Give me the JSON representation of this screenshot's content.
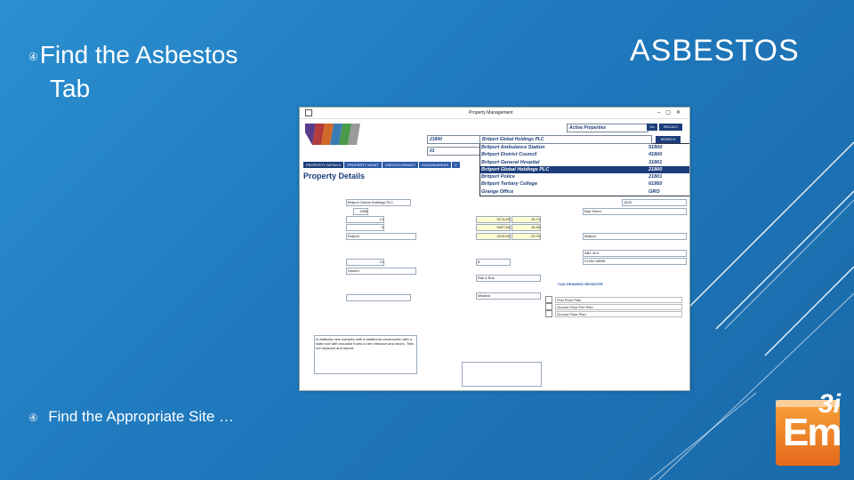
{
  "slide": {
    "bullet1_line1": "Find the Asbestos",
    "bullet1_line2": "Tab",
    "bullet2": "Find the Appropriate Site …",
    "title": "ASBESTOS",
    "bullet_marker": "④"
  },
  "app": {
    "window_title": "Property Management",
    "tabs": [
      "PROPERTY DETAILS",
      "PROPERTY MGMT",
      "USE/OCCUPANCY",
      "ROOMS/AREAS",
      "C"
    ],
    "heading": "Property Details",
    "header_code": "21800",
    "header_code2": "01",
    "header_org": "Britport Global Holdings PLC",
    "active_properties": "Active Properties",
    "search_label": "SEARCH",
    "go_label": "Go",
    "recalc_label": "RECALC",
    "dropdown": [
      {
        "name": "Britport Ambulance Station",
        "code": "51800"
      },
      {
        "name": "Britport District Council",
        "code": "41800"
      },
      {
        "name": "Britport General Hospital",
        "code": "31801"
      },
      {
        "name": "Britport Global Holdings PLC",
        "code": "21800",
        "selected": true
      },
      {
        "name": "Britport Police",
        "code": "21801"
      },
      {
        "name": "Britport Tertiary College",
        "code": "61950"
      },
      {
        "name": "Grange Office",
        "code": "GRO"
      }
    ],
    "fields": {
      "build_year": "1988",
      "beds": "14",
      "bedrooms": "0",
      "local_authority": "Britport",
      "total_parking_spaces": "10",
      "tenure": "Owned",
      "gross_int_area": "5174.63",
      "gross_int_area2": "15.74",
      "gross_ext_area": "5407.64",
      "gross_ext_area2": "16.93",
      "lettable": "3215.00",
      "lettable2": "23.79",
      "block_condition": "B",
      "public_transport": "Rail & Bus",
      "region": "Midland",
      "estates_ref": "1625",
      "address": "Bay Street",
      "town": "Britport",
      "postcode": "AB2 3CX",
      "telephone": "01264 98096",
      "comment": "A relatively new complex with a traditional construction with a slate roof with moulded fronts to the entrance and eaves. Tiles not replaced and stored.",
      "docs_header": "CAD DRAWING REGISTER",
      "docs": [
        "First Floor Plan",
        "Ground Floor Fire Plan",
        "Ground Floor Plan"
      ]
    }
  },
  "logo": {
    "mark": "Em",
    "superscript": "3i"
  }
}
